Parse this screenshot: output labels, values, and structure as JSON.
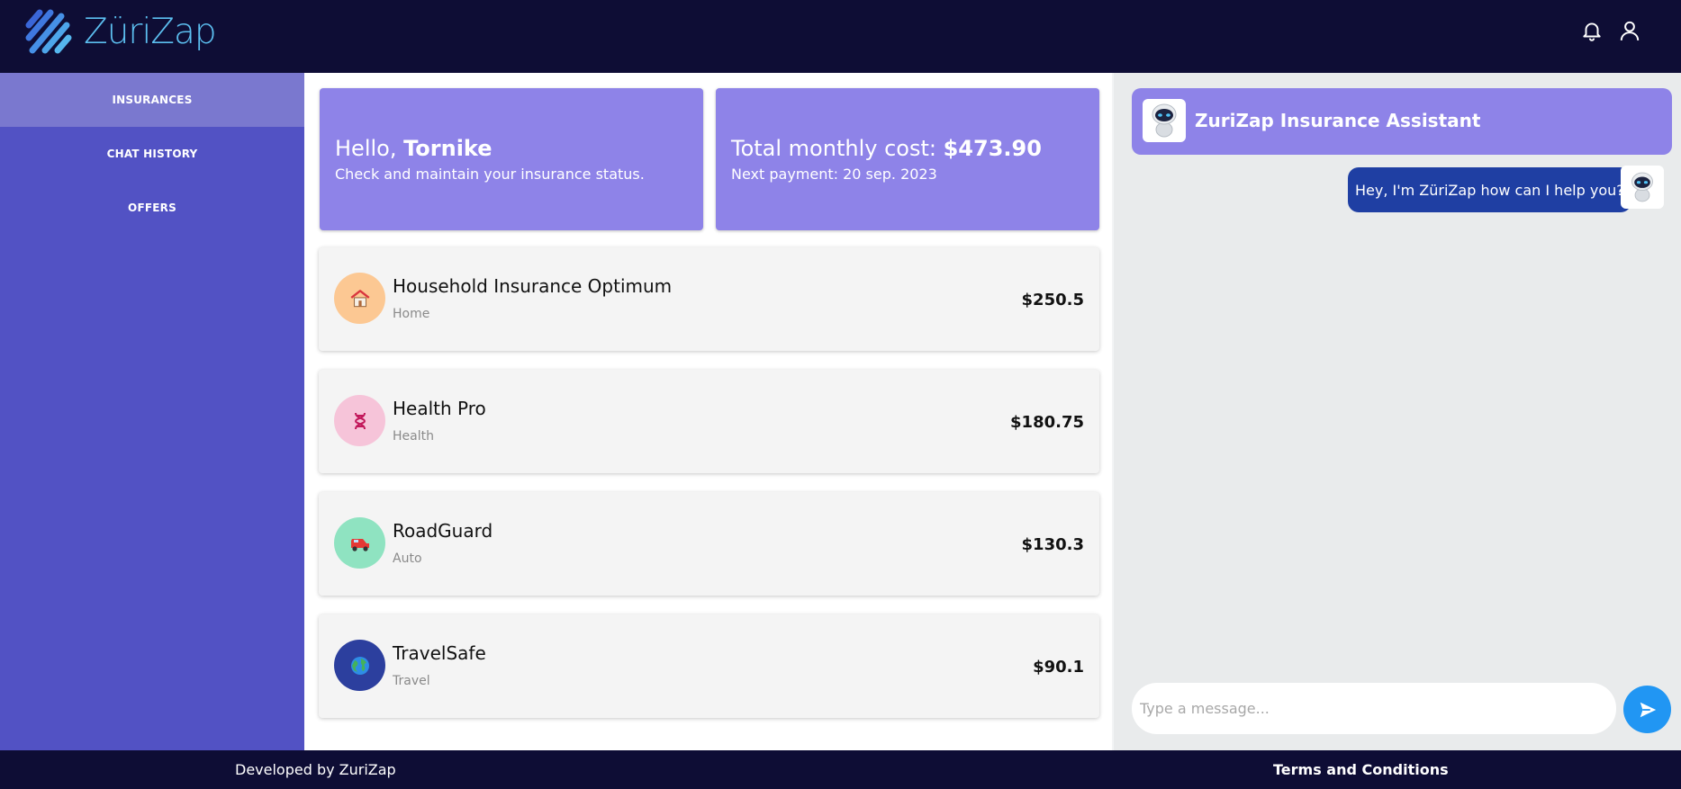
{
  "header": {
    "logo_text": "ZüriZap",
    "brand_color": "#5cbff0",
    "background": "#0e0d35",
    "icons": [
      "bell-icon",
      "user-icon"
    ]
  },
  "sidebar": {
    "items": [
      {
        "label": "INSURANCES",
        "active": true
      },
      {
        "label": "CHAT HISTORY",
        "active": false
      },
      {
        "label": "OFFERS",
        "active": false
      }
    ]
  },
  "summary": {
    "greeting_prefix": "Hello, ",
    "user_name": "Tornike",
    "greeting_sub": "Check and maintain your insurance status.",
    "cost_prefix": "Total monthly cost: ",
    "cost_value": "$473.90",
    "next_payment": "Next payment: 20 sep. 2023"
  },
  "insurances": [
    {
      "name": "Household Insurance Optimum",
      "type": "Home",
      "price": "$250.5",
      "icon": "house-icon",
      "icon_bg": "#fcc893"
    },
    {
      "name": "Health Pro",
      "type": "Health",
      "price": "$180.75",
      "icon": "dna-icon",
      "icon_bg": "#f6c4d9"
    },
    {
      "name": "RoadGuard",
      "type": "Auto",
      "price": "$130.3",
      "icon": "car-icon",
      "icon_bg": "#8fe3c1"
    },
    {
      "name": "TravelSafe",
      "type": "Travel",
      "price": "$90.1",
      "icon": "globe-icon",
      "icon_bg": "#2c3f9e"
    }
  ],
  "chat": {
    "title": "ZuriZap Insurance Assistant",
    "messages": [
      {
        "from": "bot",
        "text": "Hey, I'm ZüriZap how can I help you?"
      }
    ],
    "input_placeholder": "Type a message..."
  },
  "footer": {
    "left": "Developed by ZuriZap",
    "right": "Terms and Conditions"
  },
  "colors": {
    "sidebar": "#5252c4",
    "sidebar_active": "#7a78cf",
    "card": "#8e83e8",
    "bubble": "#1f3fa3",
    "send_button": "#2196f3"
  }
}
